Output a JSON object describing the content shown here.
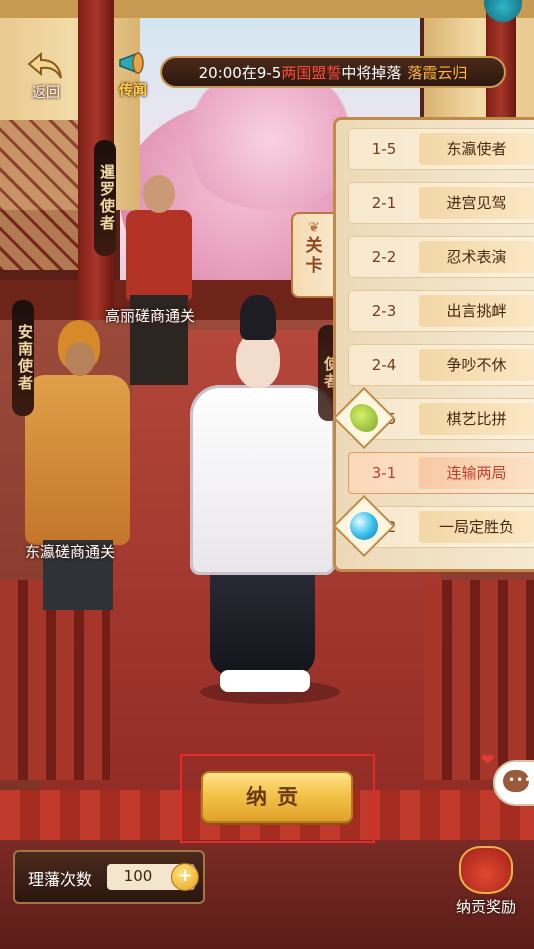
{
  "top": {
    "back_label": "返回",
    "rumor_label": "传闻",
    "marquee": {
      "prefix": "20:00在9-5",
      "highlight": "两国盟誓",
      "middle": "中将掉落",
      "item": "落霞云归"
    }
  },
  "npcs": {
    "siam_envoy": "暹罗使者",
    "annan_envoy": "安南使者",
    "third_envoy": "使者",
    "korea_trade_label": "高丽磋商通关",
    "japan_trade_label": "东瀛磋商通关"
  },
  "stage_tab": {
    "label_line1": "关",
    "label_line2": "卡"
  },
  "stages": [
    {
      "code": "1-5",
      "name": "东瀛使者"
    },
    {
      "code": "2-1",
      "name": "进宫见驾"
    },
    {
      "code": "2-2",
      "name": "忍术表演"
    },
    {
      "code": "2-3",
      "name": "出言挑衅"
    },
    {
      "code": "2-4",
      "name": "争吵不休"
    },
    {
      "code": "2-5",
      "name": "棋艺比拼"
    },
    {
      "code": "3-1",
      "name": "连输两局"
    },
    {
      "code": "3-2",
      "name": "一局定胜负"
    }
  ],
  "tribute_button": "纳贡",
  "counter": {
    "label": "理藩次数",
    "value": "100"
  },
  "reward_label": "纳贡奖励",
  "colors": {
    "accent_gold": "#f3c34a",
    "highlight_red": "#e52a2a",
    "active_stage": "#c2412e"
  }
}
